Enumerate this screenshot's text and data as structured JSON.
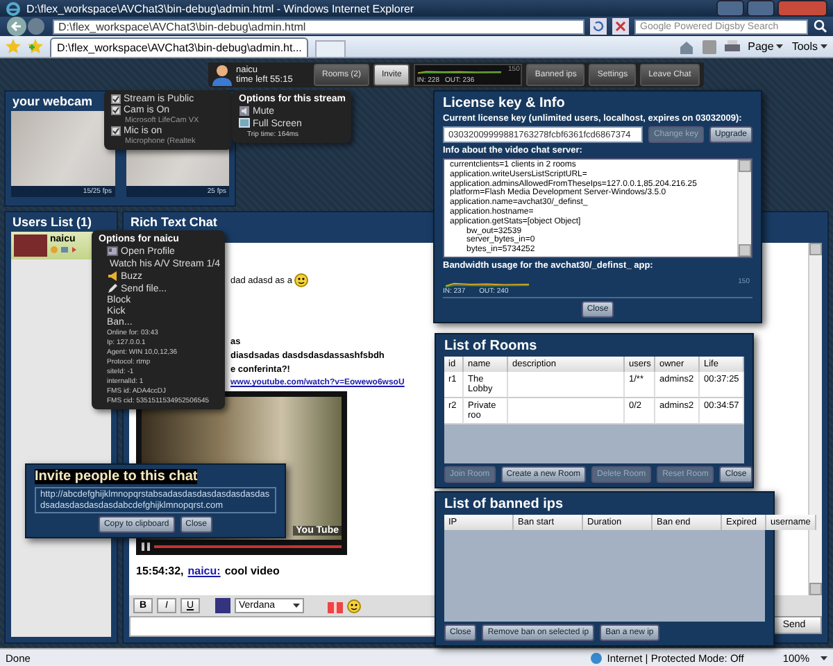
{
  "window": {
    "title": "D:\\flex_workspace\\AVChat3\\bin-debug\\admin.html - Windows Internet Explorer"
  },
  "address_bar": {
    "value": "D:\\flex_workspace\\AVChat3\\bin-debug\\admin.html"
  },
  "search": {
    "placeholder": "Google Powered Digsby Search"
  },
  "tabs": [
    {
      "label": "D:\\flex_workspace\\AVChat3\\bin-debug\\admin.ht...",
      "selected": true
    }
  ],
  "command_bar": [
    "Page",
    "Tools"
  ],
  "top_bar": {
    "user": "naicu",
    "time_left": "time left 55:15",
    "buttons_left": [
      {
        "label": "Rooms (2)",
        "selected": false
      },
      {
        "label": "Invite",
        "selected": true
      }
    ],
    "traffic": {
      "in": "IN: 228",
      "out": "OUT: 236",
      "scale": "150"
    },
    "buttons_right": [
      {
        "label": "Banned ips",
        "selected": false
      },
      {
        "label": "Settings",
        "selected": false
      },
      {
        "label": "Leave Chat",
        "selected": false
      }
    ]
  },
  "webcam": {
    "title": "your webcam",
    "cams": [
      {
        "caption": "15/25 fps"
      },
      {
        "caption": "25 fps"
      }
    ]
  },
  "stream_menu": {
    "items": [
      {
        "kind": "check",
        "label": "Stream is Public",
        "checked": true
      },
      {
        "kind": "check",
        "label": "Cam is On",
        "checked": true
      },
      {
        "kind": "device",
        "label": "Microsoft LifeCam VX"
      },
      {
        "kind": "check",
        "label": "Mic is on",
        "checked": true
      },
      {
        "kind": "device",
        "label": "Microphone (Realtek"
      }
    ]
  },
  "stream_options": {
    "title": "Options for this stream",
    "items": [
      {
        "kind": "mute",
        "label": "Mute"
      },
      {
        "kind": "fullscreen",
        "label": "Full Screen"
      }
    ],
    "trip_time": "Trip time: 164ms"
  },
  "users_list": {
    "title": "Users List (1)",
    "users": [
      {
        "name": "naicu",
        "selected": true
      }
    ]
  },
  "user_menu": {
    "title": "Options for naicu",
    "actions": [
      {
        "kind": "profile",
        "label": "Open Profile"
      },
      {
        "kind": "stream",
        "label": "Watch his A/V Stream 1/4"
      },
      {
        "kind": "buzz",
        "label": "Buzz"
      },
      {
        "kind": "file",
        "label": "Send file..."
      },
      {
        "kind": "plain",
        "label": "Block"
      },
      {
        "kind": "plain",
        "label": "Kick"
      },
      {
        "kind": "plain",
        "label": "Ban..."
      }
    ],
    "info": [
      "Online for: 03:43",
      "Ip: 127.0.0.1",
      "Agent: WIN 10,0,12,36",
      "Protocol: rtmp",
      "siteId: -1",
      "internalId: 1",
      "FMS id: ADA4ccDJ",
      "FMS cid: 5351511534952506545"
    ]
  },
  "chat": {
    "title": "Rich Text Chat",
    "messages": [
      {
        "kind": "emoji",
        "text": "dad adasd as a"
      },
      {
        "kind": "bold",
        "text": "as"
      },
      {
        "kind": "bold",
        "text": "diasdsadas dasdsdasdassashfsbdh"
      },
      {
        "kind": "bold",
        "text": "e conferinta?!"
      },
      {
        "kind": "link",
        "text": "www.youtube.com/watch?v=Eowewo6wsoU"
      },
      {
        "kind": "video",
        "text": "You Tube"
      },
      {
        "kind": "signed",
        "time": "15:54:32,",
        "user": "naicu:",
        "text": "cool video"
      }
    ],
    "toolbar": {
      "buttons": [
        "B",
        "I",
        "U"
      ],
      "font": "Verdana"
    },
    "send": "Send"
  },
  "invite": {
    "title": "Invite people to this chat",
    "url": "http://abcdefghijklmnopqrstabsadasdasdasdasdasdasdasdsadasdasdasdasdabcdefghijklmnopqrst.com",
    "buttons": [
      "Copy to clipboard",
      "Close"
    ]
  },
  "license": {
    "title": "License key & Info",
    "key_label": "Current license key (unlimited users, localhost, expires on 03032009):",
    "key": "03032009999881763278fcbf6361fcd6867374",
    "buttons": [
      {
        "label": "Change key",
        "disabled": true
      },
      {
        "label": "Upgrade",
        "disabled": false
      }
    ],
    "info_label": "Info about the video chat server:",
    "info_lines": [
      {
        "text": "currentclients=1 clients in 2 rooms"
      },
      {
        "text": "application.writeUsersListScriptURL="
      },
      {
        "text": "application.adminsAllowedFromTheseIps=127.0.0.1,85.204.216.25"
      },
      {
        "text": "platform=Flash Media Development Server-Windows/3.5.0"
      },
      {
        "text": "application.name=avchat30/_definst_"
      },
      {
        "text": "application.hostname="
      },
      {
        "text": "application.getStats=[object Object]",
        "children": [
          {
            "text": "bw_out=32539"
          },
          {
            "text": "server_bytes_in=0"
          },
          {
            "text": "bytes_in=5734252"
          }
        ]
      }
    ],
    "bandwidth_label": "Bandwidth usage for the avchat30/_definst_ app:",
    "bandwidth": {
      "in": "IN: 237",
      "out": "OUT: 240",
      "scale": "150"
    },
    "close": "Close"
  },
  "rooms": {
    "title": "List of Rooms",
    "columns": [
      "id",
      "name",
      "description",
      "users",
      "owner",
      "Life"
    ],
    "rows": [
      [
        "r1",
        "The Lobby",
        "",
        "1/**",
        "admins2",
        "00:37:25"
      ],
      [
        "r2",
        "Private roo",
        "",
        "0/2",
        "admins2",
        "00:34:57"
      ]
    ],
    "buttons": [
      {
        "label": "Join Room",
        "disabled": true
      },
      {
        "label": "Create a new Room",
        "disabled": false
      },
      {
        "label": "Delete Room",
        "disabled": true
      },
      {
        "label": "Reset Room",
        "disabled": true
      },
      {
        "label": "Close",
        "disabled": false
      }
    ]
  },
  "banned": {
    "title": "List of banned ips",
    "columns": [
      "IP",
      "Ban start",
      "Duration",
      "Ban end",
      "Expired",
      "username"
    ],
    "buttons": [
      "Close",
      "Remove ban on selected ip",
      "Ban a new ip"
    ]
  },
  "status_bar": {
    "text": "Done",
    "zone": "Internet | Protected Mode: Off",
    "zoom": "100%"
  }
}
